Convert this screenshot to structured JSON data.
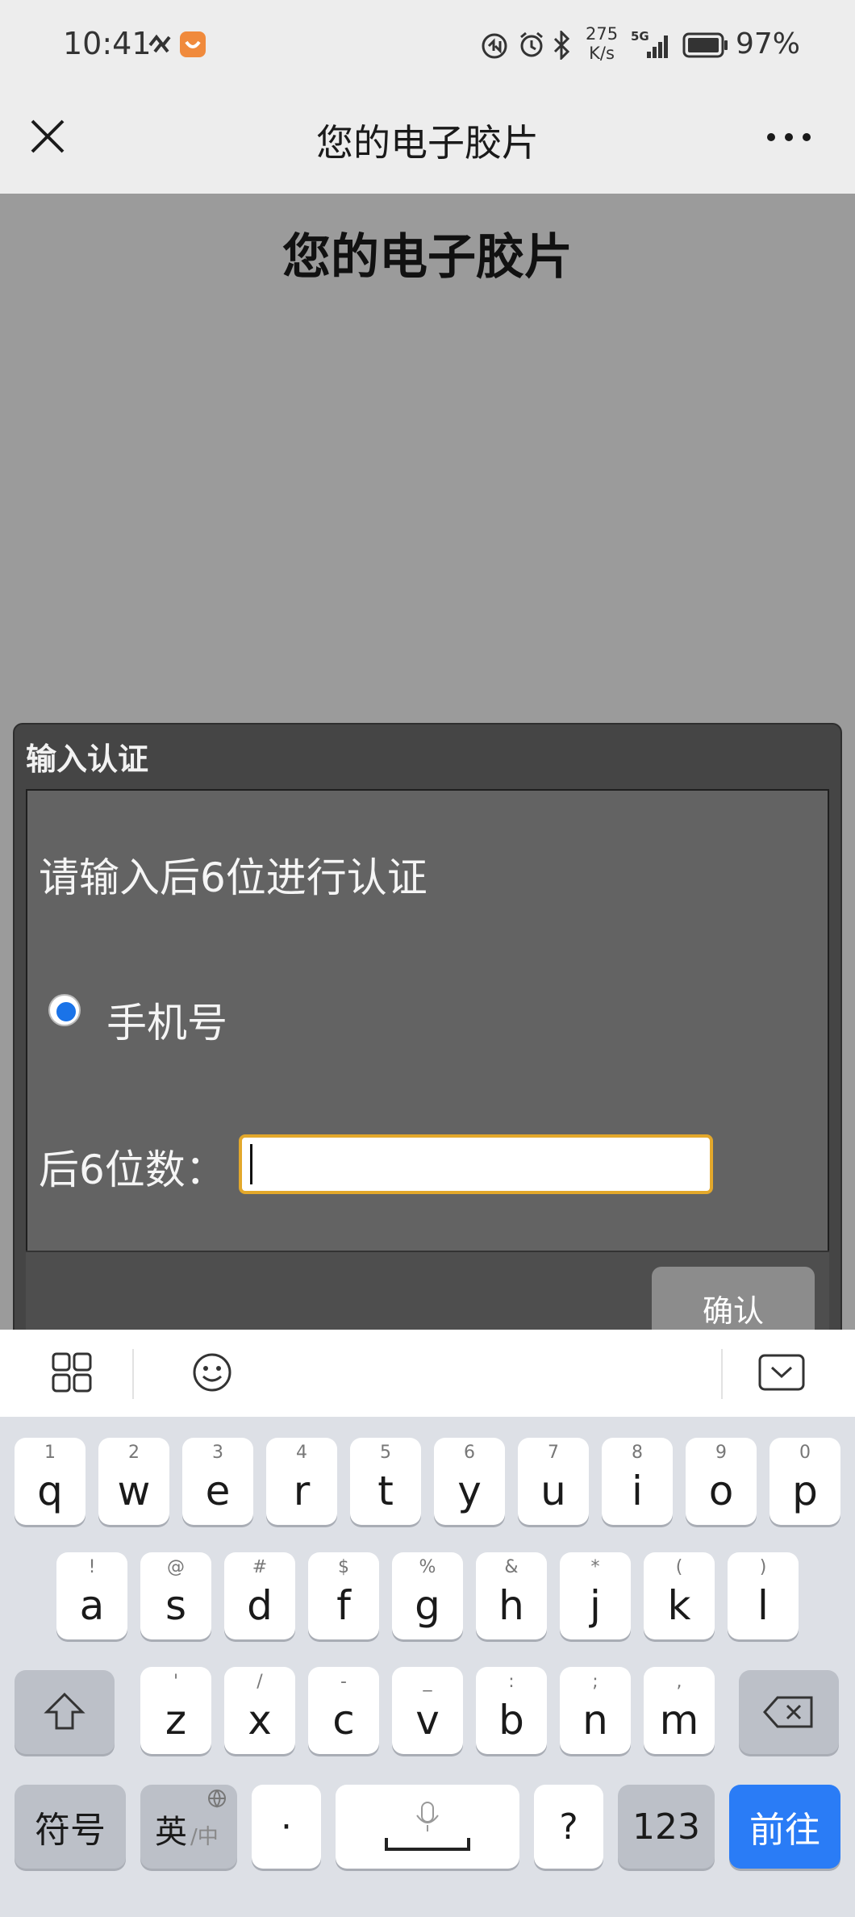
{
  "status_bar": {
    "time": "10:41",
    "net_speed_value": "275",
    "net_speed_unit": "K/s",
    "signal_label": "5G",
    "battery_percent": "97%"
  },
  "nav": {
    "title": "您的电子胶片"
  },
  "page": {
    "title": "您的电子胶片"
  },
  "dialog": {
    "title": "输入认证",
    "prompt": "请输入后6位进行认证",
    "radio_label": "手机号",
    "field_label": "后6位数：",
    "input_value": "",
    "confirm_label": "确认",
    "input_border_color": "#e3a82b",
    "radio_color": "#1a73e8"
  },
  "keyboard": {
    "row1": [
      {
        "main": "q",
        "sub": "1"
      },
      {
        "main": "w",
        "sub": "2"
      },
      {
        "main": "e",
        "sub": "3"
      },
      {
        "main": "r",
        "sub": "4"
      },
      {
        "main": "t",
        "sub": "5"
      },
      {
        "main": "y",
        "sub": "6"
      },
      {
        "main": "u",
        "sub": "7"
      },
      {
        "main": "i",
        "sub": "8"
      },
      {
        "main": "o",
        "sub": "9"
      },
      {
        "main": "p",
        "sub": "0"
      }
    ],
    "row2": [
      {
        "main": "a",
        "sub": "!"
      },
      {
        "main": "s",
        "sub": "@"
      },
      {
        "main": "d",
        "sub": "#"
      },
      {
        "main": "f",
        "sub": "$"
      },
      {
        "main": "g",
        "sub": "%"
      },
      {
        "main": "h",
        "sub": "&"
      },
      {
        "main": "j",
        "sub": "*"
      },
      {
        "main": "k",
        "sub": "("
      },
      {
        "main": "l",
        "sub": ")"
      }
    ],
    "row3": [
      {
        "main": "z",
        "sub": "'"
      },
      {
        "main": "x",
        "sub": "/"
      },
      {
        "main": "c",
        "sub": "-"
      },
      {
        "main": "v",
        "sub": "_"
      },
      {
        "main": "b",
        "sub": ":"
      },
      {
        "main": "n",
        "sub": ";"
      },
      {
        "main": "m",
        "sub": ","
      }
    ],
    "symbols_label": "符号",
    "lang_main": "英",
    "lang_sub": "/中",
    "dot_label": "·",
    "question_label": "?",
    "numbers_label": "123",
    "go_label": "前往",
    "go_color": "#2a7cf6"
  }
}
